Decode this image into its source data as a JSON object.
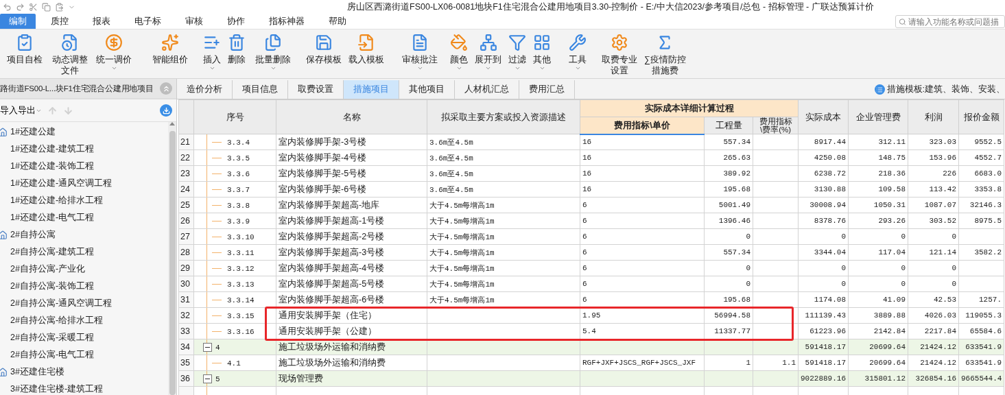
{
  "window": {
    "title": "房山区西潞街道FS00-LX06-0081地块F1住宅混合公建用地项目3.30-控制价 - E:/中大信2023/参考项目/总包 - 招标管理 - 广联达预算计价"
  },
  "menu": [
    {
      "label": "编制",
      "selected": true
    },
    {
      "label": "质控",
      "selected": false
    },
    {
      "label": "报表",
      "selected": false
    },
    {
      "label": "电子标",
      "selected": false
    },
    {
      "label": "审核",
      "selected": false
    },
    {
      "label": "协作",
      "selected": false
    },
    {
      "label": "指标神器",
      "selected": false
    },
    {
      "label": "帮助",
      "selected": false
    }
  ],
  "search": {
    "placeholder": "请输入功能名称或问题描"
  },
  "ribbon": [
    {
      "lines": [
        "项目自检"
      ],
      "dropdown": false
    },
    {
      "lines": [
        "动态调整",
        "文件"
      ],
      "dropdown": false
    },
    {
      "lines": [
        "统一调价"
      ],
      "dropdown": true
    },
    {
      "lines": [
        "智能组价"
      ],
      "dropdown": false
    },
    {
      "lines": [
        "插入"
      ],
      "dropdown": true
    },
    {
      "lines": [
        "删除"
      ],
      "dropdown": false
    },
    {
      "lines": [
        "批量删除"
      ],
      "dropdown": true
    },
    {
      "lines": [
        "保存模板"
      ],
      "dropdown": false
    },
    {
      "lines": [
        "载入模板"
      ],
      "dropdown": false
    },
    {
      "lines": [
        "审核批注"
      ],
      "dropdown": true
    },
    {
      "lines": [
        "颜色"
      ],
      "dropdown": true
    },
    {
      "lines": [
        "展开到"
      ],
      "dropdown": true
    },
    {
      "lines": [
        "过滤"
      ],
      "dropdown": true
    },
    {
      "lines": [
        "其他"
      ],
      "dropdown": true
    },
    {
      "lines": [
        "工具"
      ],
      "dropdown": true
    },
    {
      "lines": [
        "取费专业",
        "设置"
      ],
      "dropdown": false
    },
    {
      "lines": [
        "∑疫情防控",
        "措施费"
      ],
      "dropdown": false
    }
  ],
  "sidebar": {
    "title": "路街道FS00-L...块F1住宅混合公建用地项目",
    "toolbar_label": "导入导出",
    "items": [
      {
        "label": "1#还建公建",
        "children": [
          {
            "label": "1#还建公建-建筑工程"
          },
          {
            "label": "1#还建公建-装饰工程"
          },
          {
            "label": "1#还建公建-通风空调工程"
          },
          {
            "label": "1#还建公建-给排水工程"
          },
          {
            "label": "1#还建公建-电气工程"
          }
        ]
      },
      {
        "label": "2#自持公寓",
        "children": [
          {
            "label": "2#自持公寓-建筑工程"
          },
          {
            "label": "2#自持公寓-产业化"
          },
          {
            "label": "2#自持公寓-装饰工程"
          },
          {
            "label": "2#自持公寓-通风空调工程"
          },
          {
            "label": "2#自持公寓-给排水工程"
          },
          {
            "label": "2#自持公寓-采暖工程"
          },
          {
            "label": "2#自持公寓-电气工程"
          }
        ]
      },
      {
        "label": "3#还建住宅楼",
        "children": [
          {
            "label": "3#还建住宅楼-建筑工程"
          }
        ]
      }
    ]
  },
  "tabs": [
    {
      "label": "造价分析",
      "selected": false
    },
    {
      "label": "项目信息",
      "selected": false
    },
    {
      "label": "取费设置",
      "selected": false
    },
    {
      "label": "措施项目",
      "selected": true
    },
    {
      "label": "其他项目",
      "selected": false
    },
    {
      "label": "人材机汇总",
      "selected": false
    },
    {
      "label": "费用汇总",
      "selected": false
    }
  ],
  "template_label": "措施模板:建筑、装饰、安装、",
  "table": {
    "columns": {
      "code": "序号",
      "name": "名称",
      "desc": "拟采取主要方案或投入资源描述",
      "group": "实际成本详细计算过程",
      "cost": "实际成本",
      "mgmt": "企业管理费",
      "profit": "利润",
      "quote": "报价金额"
    },
    "subcolumns": [
      {
        "label": "费用指标\\单价",
        "selected": true
      },
      {
        "label": "工程量",
        "selected": false
      },
      {
        "label": "费用指标\\费率(%)",
        "selected": false
      }
    ],
    "rows": [
      {
        "kind": "item",
        "num": "21",
        "code": "3.3.4",
        "name": "室内装修脚手架-3号楼",
        "desc": "3.6m至4.5m",
        "unit": "16",
        "qty": "557.34",
        "cost": "8917.44",
        "mgmt": "312.11",
        "profit": "323.03",
        "quote": "9552.5",
        "marked": false
      },
      {
        "kind": "item",
        "num": "22",
        "code": "3.3.5",
        "name": "室内装修脚手架-4号楼",
        "desc": "3.6m至4.5m",
        "unit": "16",
        "qty": "265.63",
        "cost": "4250.08",
        "mgmt": "148.75",
        "profit": "153.96",
        "quote": "4552.7",
        "marked": false
      },
      {
        "kind": "item",
        "num": "23",
        "code": "3.3.6",
        "name": "室内装修脚手架-5号楼",
        "desc": "3.6m至4.5m",
        "unit": "16",
        "qty": "389.92",
        "cost": "6238.72",
        "mgmt": "218.36",
        "profit": "226",
        "quote": "6683.0",
        "marked": false
      },
      {
        "kind": "item",
        "num": "24",
        "code": "3.3.7",
        "name": "室内装修脚手架-6号楼",
        "desc": "3.6m至4.5m",
        "unit": "16",
        "qty": "195.68",
        "cost": "3130.88",
        "mgmt": "109.58",
        "profit": "113.42",
        "quote": "3353.8",
        "marked": false
      },
      {
        "kind": "item",
        "num": "25",
        "code": "3.3.8",
        "name": "室内装修脚手架超高-地库",
        "desc": "大于4.5m每增高1m",
        "unit": "6",
        "qty": "5001.49",
        "cost": "30008.94",
        "mgmt": "1050.31",
        "profit": "1087.07",
        "quote": "32146.3",
        "marked": false
      },
      {
        "kind": "item",
        "num": "26",
        "code": "3.3.9",
        "name": "室内装修脚手架超高-1号楼",
        "desc": "大于4.5m每增高1m",
        "unit": "6",
        "qty": "1396.46",
        "cost": "8378.76",
        "mgmt": "293.26",
        "profit": "303.52",
        "quote": "8975.5",
        "marked": false
      },
      {
        "kind": "item",
        "num": "27",
        "code": "3.3.10",
        "name": "室内装修脚手架超高-2号楼",
        "desc": "大于4.5m每增高1m",
        "unit": "6",
        "qty": "0",
        "cost": "0",
        "mgmt": "0",
        "profit": "0",
        "marked": false
      },
      {
        "kind": "item",
        "num": "28",
        "code": "3.3.11",
        "name": "室内装修脚手架超高-3号楼",
        "desc": "大于4.5m每增高1m",
        "unit": "6",
        "qty": "557.34",
        "cost": "3344.04",
        "mgmt": "117.04",
        "profit": "121.14",
        "quote": "3582.2",
        "marked": false
      },
      {
        "kind": "item",
        "num": "29",
        "code": "3.3.12",
        "name": "室内装修脚手架超高-4号楼",
        "desc": "大于4.5m每增高1m",
        "unit": "6",
        "qty": "0",
        "cost": "0",
        "mgmt": "0",
        "profit": "0",
        "marked": false
      },
      {
        "kind": "item",
        "num": "30",
        "code": "3.3.13",
        "name": "室内装修脚手架超高-5号楼",
        "desc": "大于4.5m每增高1m",
        "unit": "6",
        "qty": "0",
        "cost": "0",
        "mgmt": "0",
        "profit": "0",
        "marked": false
      },
      {
        "kind": "item",
        "num": "31",
        "code": "3.3.14",
        "name": "室内装修脚手架超高-6号楼",
        "desc": "大于4.5m每增高1m",
        "unit": "6",
        "qty": "195.68",
        "cost": "1174.08",
        "mgmt": "41.09",
        "profit": "42.53",
        "quote": "1257.",
        "marked": false
      },
      {
        "kind": "item",
        "num": "32",
        "code": "3.3.15",
        "name": "通用安装脚手架（住宅）",
        "unit": "1.95",
        "qty": "56994.58",
        "cost": "111139.43",
        "mgmt": "3889.88",
        "profit": "4026.03",
        "quote": "119055.3",
        "marked": true
      },
      {
        "kind": "item",
        "num": "33",
        "code": "3.3.16",
        "name": "通用安装脚手架（公建）",
        "unit": "5.4",
        "qty": "11337.77",
        "cost": "61223.96",
        "mgmt": "2142.84",
        "profit": "2217.84",
        "quote": "65584.6",
        "marked": true
      },
      {
        "kind": "group",
        "expanded": true,
        "num": "34",
        "code": "4",
        "name": "施工垃圾场外运输和消纳费",
        "cost": "591418.17",
        "mgmt": "20699.64",
        "profit": "21424.12",
        "quote": "633541.9",
        "marked": false
      },
      {
        "kind": "item",
        "num": "35",
        "code": "4.1",
        "name": "施工垃圾场外运输和消纳费",
        "unit": "RGF+JXF+JSCS_RGF+JSCS_JXF",
        "qty": "1",
        "rate": "1.1",
        "cost": "591418.17",
        "mgmt": "20699.64",
        "profit": "21424.12",
        "quote": "633541.9",
        "marked": false
      },
      {
        "kind": "group",
        "expanded": true,
        "num": "36",
        "code": "5",
        "name": "现场管理费",
        "cost": "9022889.16",
        "mgmt": "315801.12",
        "profit": "326854.16",
        "quote": "9665544.4",
        "marked": false
      }
    ]
  }
}
